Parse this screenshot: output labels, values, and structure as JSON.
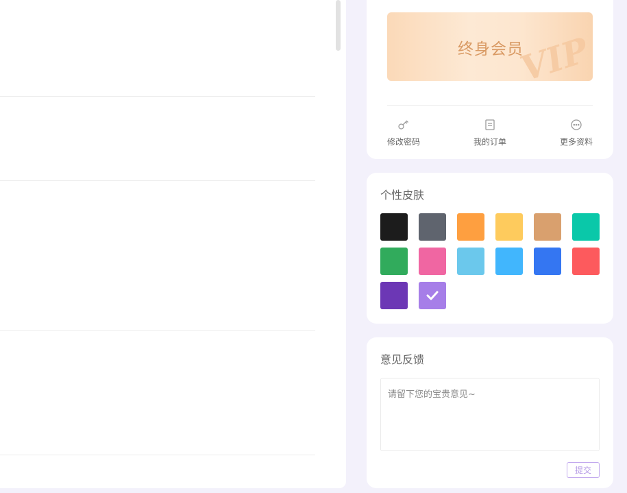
{
  "profile": {
    "vip_title": "终身会员",
    "vip_watermark": "VIP",
    "actions": [
      {
        "label": "修改密码",
        "icon": "key-icon"
      },
      {
        "label": "我的订单",
        "icon": "order-icon"
      },
      {
        "label": "更多资料",
        "icon": "more-icon"
      }
    ]
  },
  "skin": {
    "title": "个性皮肤",
    "colors": [
      "#1c1c1c",
      "#5f646e",
      "#fe9f40",
      "#fecb5d",
      "#d9a06e",
      "#0ac8a9",
      "#31ab5c",
      "#f066a2",
      "#6bc8ec",
      "#41b6fd",
      "#3476f2",
      "#fd5a5d",
      "#6c37b5",
      "#a67ee8"
    ],
    "selected_index": 13
  },
  "feedback": {
    "title": "意见反馈",
    "placeholder": "请留下您的宝贵意见~",
    "submit_label": "提交"
  }
}
